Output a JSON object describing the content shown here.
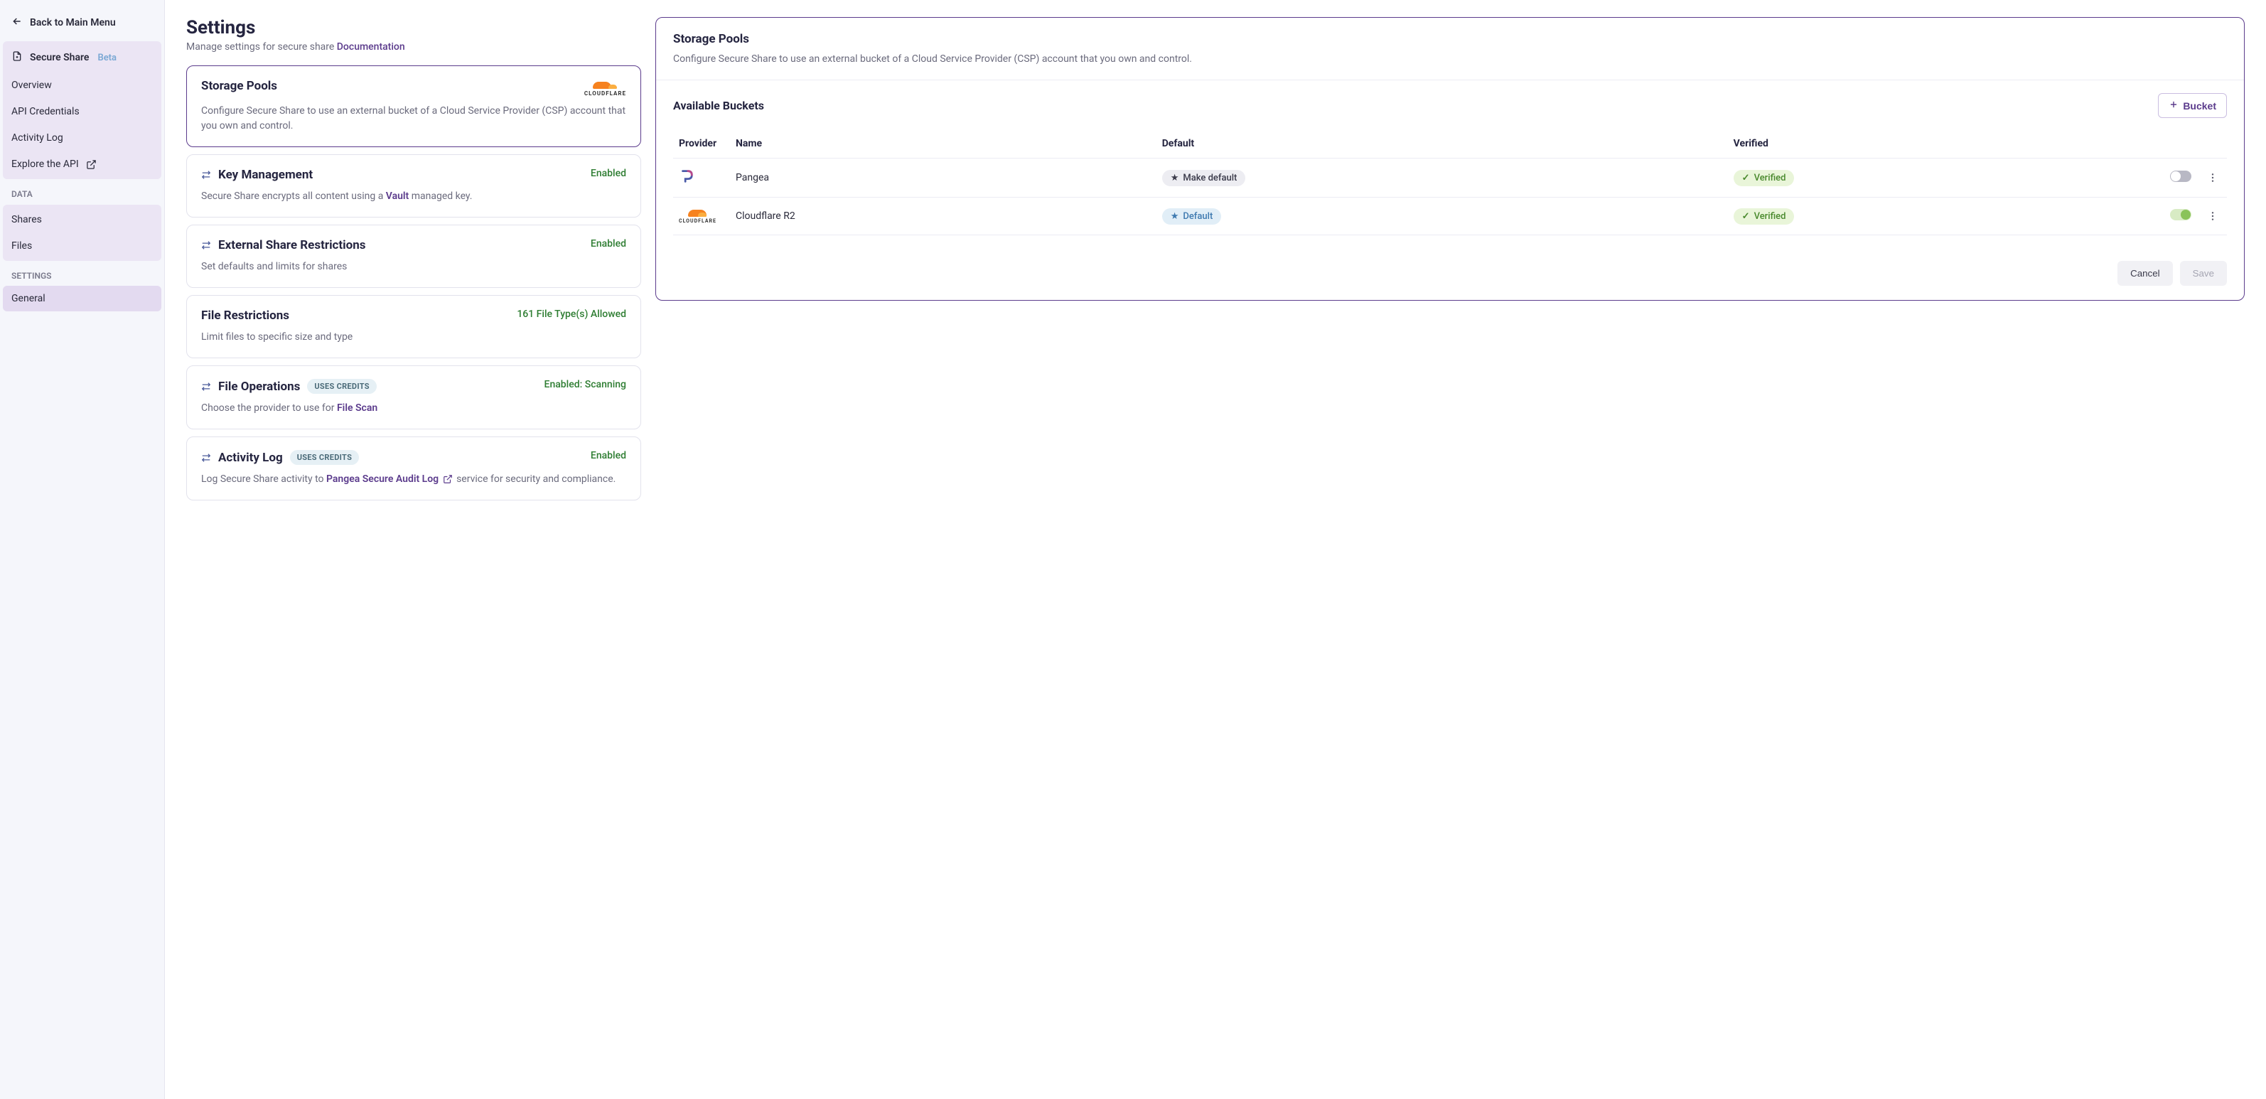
{
  "sidebar": {
    "back_label": "Back to Main Menu",
    "top_item": {
      "label": "Secure Share",
      "beta": "Beta"
    },
    "nav1": [
      "Overview",
      "API Credentials",
      "Activity Log",
      "Explore the API"
    ],
    "section_data": "DATA",
    "data_items": [
      "Shares",
      "Files"
    ],
    "section_settings": "SETTINGS",
    "settings_items": [
      "General"
    ]
  },
  "page": {
    "title": "Settings",
    "sub_pre": "Manage settings for secure share ",
    "doc_link": "Documentation"
  },
  "cards": {
    "storage": {
      "title": "Storage Pools",
      "desc": "Configure Secure Share to use an external bucket of a Cloud Service Provider (CSP) account that you own and control."
    },
    "key": {
      "title": "Key Management",
      "desc_pre": "Secure Share encrypts all content using a ",
      "desc_link": "Vault",
      "desc_post": " managed key.",
      "status": "Enabled"
    },
    "ext_share": {
      "title": "External Share Restrictions",
      "desc": "Set defaults and limits for shares",
      "status": "Enabled"
    },
    "file_restrict": {
      "title": "File Restrictions",
      "desc": "Limit files to specific size and type",
      "status": "161 File Type(s) Allowed"
    },
    "file_ops": {
      "title": "File Operations",
      "pill": "USES CREDITS",
      "desc_pre": "Choose the provider to use for ",
      "desc_link": "File Scan",
      "status": "Enabled: Scanning"
    },
    "activity_log": {
      "title": "Activity Log",
      "pill": "USES CREDITS",
      "desc_pre": "Log Secure Share activity to ",
      "desc_link": "Pangea Secure Audit Log",
      "desc_post": " service for security and compliance.",
      "status": "Enabled"
    }
  },
  "panel": {
    "title": "Storage Pools",
    "desc": "Configure Secure Share to use an external bucket of a Cloud Service Provider (CSP) account that you own and control.",
    "avail_title": "Available Buckets",
    "add_bucket_label": "Bucket",
    "headers": {
      "provider": "Provider",
      "name": "Name",
      "default": "Default",
      "verified": "Verified"
    },
    "rows": [
      {
        "name": "Pangea",
        "default_label": "Make default",
        "is_default": false,
        "verified": "Verified",
        "enabled": false
      },
      {
        "name": "Cloudflare R2",
        "default_label": "Default",
        "is_default": true,
        "verified": "Verified",
        "enabled": true
      }
    ],
    "cancel": "Cancel",
    "save": "Save"
  }
}
